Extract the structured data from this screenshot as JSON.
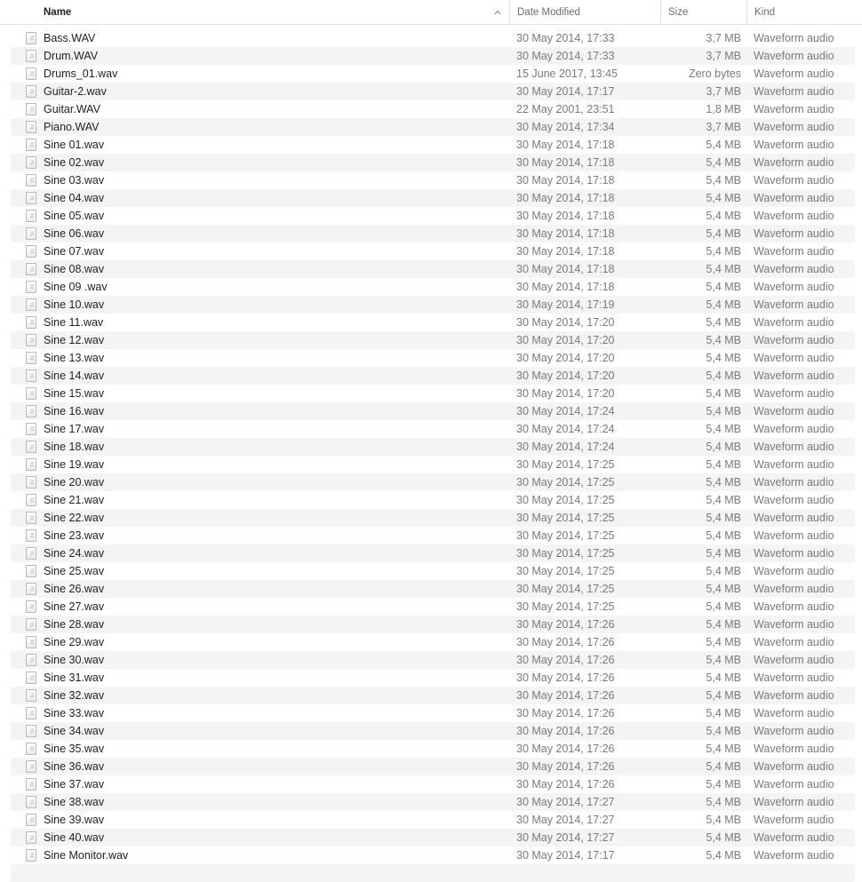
{
  "columns": {
    "name": "Name",
    "date": "Date Modified",
    "size": "Size",
    "kind": "Kind"
  },
  "sort": {
    "column": "name",
    "direction": "ascending",
    "icon": "chevron-up-icon"
  },
  "file_icon": "audio-file-icon",
  "files": [
    {
      "name": "Bass.WAV",
      "date": "30 May 2014, 17:33",
      "size": "3,7 MB",
      "kind": "Waveform audio"
    },
    {
      "name": "Drum.WAV",
      "date": "30 May 2014, 17:33",
      "size": "3,7 MB",
      "kind": "Waveform audio"
    },
    {
      "name": "Drums_01.wav",
      "date": "15 June 2017, 13:45",
      "size": "Zero bytes",
      "kind": "Waveform audio"
    },
    {
      "name": "Guitar-2.wav",
      "date": "30 May 2014, 17:17",
      "size": "3,7 MB",
      "kind": "Waveform audio"
    },
    {
      "name": "Guitar.WAV",
      "date": "22 May 2001, 23:51",
      "size": "1,8 MB",
      "kind": "Waveform audio"
    },
    {
      "name": "Piano.WAV",
      "date": "30 May 2014, 17:34",
      "size": "3,7 MB",
      "kind": "Waveform audio"
    },
    {
      "name": "Sine 01.wav",
      "date": "30 May 2014, 17:18",
      "size": "5,4 MB",
      "kind": "Waveform audio"
    },
    {
      "name": "Sine 02.wav",
      "date": "30 May 2014, 17:18",
      "size": "5,4 MB",
      "kind": "Waveform audio"
    },
    {
      "name": "Sine 03.wav",
      "date": "30 May 2014, 17:18",
      "size": "5,4 MB",
      "kind": "Waveform audio"
    },
    {
      "name": "Sine 04.wav",
      "date": "30 May 2014, 17:18",
      "size": "5,4 MB",
      "kind": "Waveform audio"
    },
    {
      "name": "Sine 05.wav",
      "date": "30 May 2014, 17:18",
      "size": "5,4 MB",
      "kind": "Waveform audio"
    },
    {
      "name": "Sine 06.wav",
      "date": "30 May 2014, 17:18",
      "size": "5,4 MB",
      "kind": "Waveform audio"
    },
    {
      "name": "Sine 07.wav",
      "date": "30 May 2014, 17:18",
      "size": "5,4 MB",
      "kind": "Waveform audio"
    },
    {
      "name": "Sine 08.wav",
      "date": "30 May 2014, 17:18",
      "size": "5,4 MB",
      "kind": "Waveform audio"
    },
    {
      "name": "Sine 09 .wav",
      "date": "30 May 2014, 17:18",
      "size": "5,4 MB",
      "kind": "Waveform audio"
    },
    {
      "name": "Sine 10.wav",
      "date": "30 May 2014, 17:19",
      "size": "5,4 MB",
      "kind": "Waveform audio"
    },
    {
      "name": "Sine 11.wav",
      "date": "30 May 2014, 17:20",
      "size": "5,4 MB",
      "kind": "Waveform audio"
    },
    {
      "name": "Sine 12.wav",
      "date": "30 May 2014, 17:20",
      "size": "5,4 MB",
      "kind": "Waveform audio"
    },
    {
      "name": "Sine 13.wav",
      "date": "30 May 2014, 17:20",
      "size": "5,4 MB",
      "kind": "Waveform audio"
    },
    {
      "name": "Sine 14.wav",
      "date": "30 May 2014, 17:20",
      "size": "5,4 MB",
      "kind": "Waveform audio"
    },
    {
      "name": "Sine 15.wav",
      "date": "30 May 2014, 17:20",
      "size": "5,4 MB",
      "kind": "Waveform audio"
    },
    {
      "name": "Sine 16.wav",
      "date": "30 May 2014, 17:24",
      "size": "5,4 MB",
      "kind": "Waveform audio"
    },
    {
      "name": "Sine 17.wav",
      "date": "30 May 2014, 17:24",
      "size": "5,4 MB",
      "kind": "Waveform audio"
    },
    {
      "name": "Sine 18.wav",
      "date": "30 May 2014, 17:24",
      "size": "5,4 MB",
      "kind": "Waveform audio"
    },
    {
      "name": "Sine 19.wav",
      "date": "30 May 2014, 17:25",
      "size": "5,4 MB",
      "kind": "Waveform audio"
    },
    {
      "name": "Sine 20.wav",
      "date": "30 May 2014, 17:25",
      "size": "5,4 MB",
      "kind": "Waveform audio"
    },
    {
      "name": "Sine 21.wav",
      "date": "30 May 2014, 17:25",
      "size": "5,4 MB",
      "kind": "Waveform audio"
    },
    {
      "name": "Sine 22.wav",
      "date": "30 May 2014, 17:25",
      "size": "5,4 MB",
      "kind": "Waveform audio"
    },
    {
      "name": "Sine 23.wav",
      "date": "30 May 2014, 17:25",
      "size": "5,4 MB",
      "kind": "Waveform audio"
    },
    {
      "name": "Sine 24.wav",
      "date": "30 May 2014, 17:25",
      "size": "5,4 MB",
      "kind": "Waveform audio"
    },
    {
      "name": "Sine 25.wav",
      "date": "30 May 2014, 17:25",
      "size": "5,4 MB",
      "kind": "Waveform audio"
    },
    {
      "name": "Sine 26.wav",
      "date": "30 May 2014, 17:25",
      "size": "5,4 MB",
      "kind": "Waveform audio"
    },
    {
      "name": "Sine 27.wav",
      "date": "30 May 2014, 17:25",
      "size": "5,4 MB",
      "kind": "Waveform audio"
    },
    {
      "name": "Sine 28.wav",
      "date": "30 May 2014, 17:26",
      "size": "5,4 MB",
      "kind": "Waveform audio"
    },
    {
      "name": "Sine 29.wav",
      "date": "30 May 2014, 17:26",
      "size": "5,4 MB",
      "kind": "Waveform audio"
    },
    {
      "name": "Sine 30.wav",
      "date": "30 May 2014, 17:26",
      "size": "5,4 MB",
      "kind": "Waveform audio"
    },
    {
      "name": "Sine 31.wav",
      "date": "30 May 2014, 17:26",
      "size": "5,4 MB",
      "kind": "Waveform audio"
    },
    {
      "name": "Sine 32.wav",
      "date": "30 May 2014, 17:26",
      "size": "5,4 MB",
      "kind": "Waveform audio"
    },
    {
      "name": "Sine 33.wav",
      "date": "30 May 2014, 17:26",
      "size": "5,4 MB",
      "kind": "Waveform audio"
    },
    {
      "name": "Sine 34.wav",
      "date": "30 May 2014, 17:26",
      "size": "5,4 MB",
      "kind": "Waveform audio"
    },
    {
      "name": "Sine 35.wav",
      "date": "30 May 2014, 17:26",
      "size": "5,4 MB",
      "kind": "Waveform audio"
    },
    {
      "name": "Sine 36.wav",
      "date": "30 May 2014, 17:26",
      "size": "5,4 MB",
      "kind": "Waveform audio"
    },
    {
      "name": "Sine 37.wav",
      "date": "30 May 2014, 17:26",
      "size": "5,4 MB",
      "kind": "Waveform audio"
    },
    {
      "name": "Sine 38.wav",
      "date": "30 May 2014, 17:27",
      "size": "5,4 MB",
      "kind": "Waveform audio"
    },
    {
      "name": "Sine 39.wav",
      "date": "30 May 2014, 17:27",
      "size": "5,4 MB",
      "kind": "Waveform audio"
    },
    {
      "name": "Sine 40.wav",
      "date": "30 May 2014, 17:27",
      "size": "5,4 MB",
      "kind": "Waveform audio"
    },
    {
      "name": "Sine Monitor.wav",
      "date": "30 May 2014, 17:17",
      "size": "5,4 MB",
      "kind": "Waveform audio"
    }
  ]
}
